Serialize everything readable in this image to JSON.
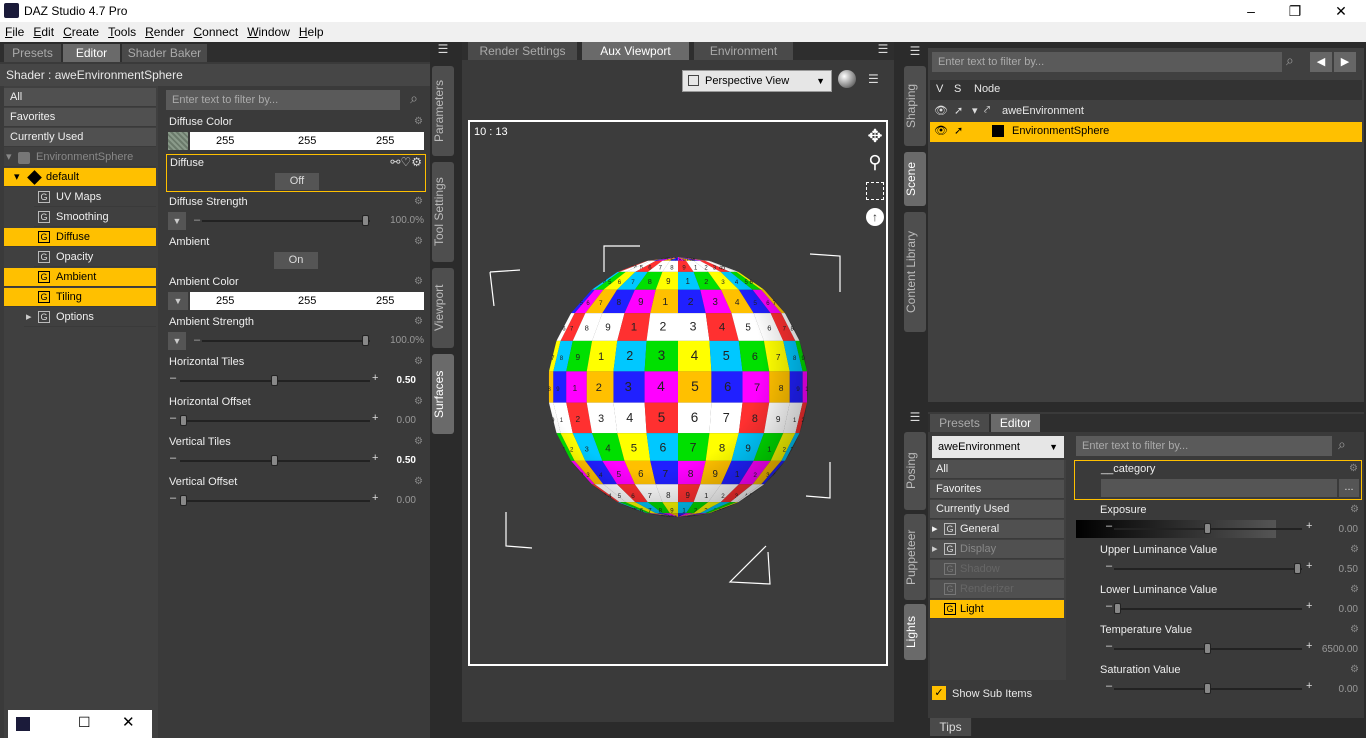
{
  "window": {
    "title": "DAZ Studio 4.7 Pro",
    "min": "–",
    "max": "❐",
    "close": "✕"
  },
  "menu": [
    "File",
    "Edit",
    "Create",
    "Tools",
    "Render",
    "Connect",
    "Window",
    "Help"
  ],
  "left": {
    "tabs": [
      "Presets",
      "Editor",
      "Shader Baker"
    ],
    "shader_label": "Shader : aweEnvironmentSphere",
    "filter_placeholder": "Enter text to filter by...",
    "categories": [
      "All",
      "Favorites",
      "Currently Used"
    ],
    "tree": [
      {
        "label": "EnvironmentSphere"
      },
      {
        "label": "default"
      },
      {
        "label": "UV Maps"
      },
      {
        "label": "Smoothing"
      },
      {
        "label": "Diffuse"
      },
      {
        "label": "Opacity"
      },
      {
        "label": "Ambient"
      },
      {
        "label": "Tiling"
      },
      {
        "label": "Options"
      }
    ],
    "props": {
      "diffuse_color": {
        "name": "Diffuse Color",
        "r": "255",
        "g": "255",
        "b": "255"
      },
      "diffuse": {
        "name": "Diffuse",
        "value": "Off"
      },
      "diffuse_strength": {
        "name": "Diffuse Strength",
        "value": "100.0%",
        "level": 1.0
      },
      "ambient": {
        "name": "Ambient",
        "value": "On"
      },
      "ambient_color": {
        "name": "Ambient Color",
        "r": "255",
        "g": "255",
        "b": "255"
      },
      "ambient_strength": {
        "name": "Ambient Strength",
        "value": "100.0%",
        "level": 1.0
      },
      "horizontal_tiles": {
        "name": "Horizontal Tiles",
        "value": "0.50",
        "level": 0.5
      },
      "horizontal_offset": {
        "name": "Horizontal Offset",
        "value": "0.00",
        "level": 0.0
      },
      "vertical_tiles": {
        "name": "Vertical Tiles",
        "value": "0.50",
        "level": 0.5
      },
      "vertical_offset": {
        "name": "Vertical Offset",
        "value": "0.00",
        "level": 0.0
      }
    }
  },
  "left_vtabs": [
    "Parameters",
    "Tool Settings",
    "Viewport",
    "Surfaces"
  ],
  "center": {
    "tabs": [
      "Render Settings",
      "Aux Viewport",
      "Environment"
    ],
    "view_select": "Perspective View",
    "fps": "10 : 13",
    "sphere_digits": [
      "2",
      "3",
      "4",
      "5",
      "6",
      "7",
      "8",
      "9",
      "1"
    ],
    "sphere_colors": [
      "#ff00ff",
      "#00c8ff",
      "#ffffff",
      "#ffc000",
      "#00e000",
      "#ff3030",
      "#2020ff",
      "#ffff00",
      "#ffffff"
    ]
  },
  "right_vtabs": [
    "Shaping",
    "Scene",
    "Content Library"
  ],
  "right_vtabs2": [
    "Posing",
    "Puppeteer",
    "Lights"
  ],
  "scene": {
    "filter_placeholder": "Enter text to filter by...",
    "headers": [
      "V",
      "S",
      "Node"
    ],
    "nodes": [
      {
        "label": "aweEnvironment"
      },
      {
        "label": "EnvironmentSphere"
      }
    ]
  },
  "editor": {
    "tabs": [
      "Presets",
      "Editor"
    ],
    "node_select": "aweEnvironment",
    "filter_placeholder": "Enter text to filter by...",
    "categories": [
      "All",
      "Favorites",
      "Currently Used"
    ],
    "groups": [
      "General",
      "Display",
      "Shadow",
      "Renderizer",
      "Light"
    ],
    "show_sub": "Show Sub Items",
    "props": {
      "category": {
        "name": "__category",
        "btn": "..."
      },
      "exposure": {
        "name": "Exposure",
        "value": "0.00",
        "level": 0.5
      },
      "upper": {
        "name": "Upper Luminance Value",
        "value": "0.50",
        "level": 1.0
      },
      "lower": {
        "name": "Lower Luminance Value",
        "value": "0.00",
        "level": 0.0
      },
      "temperature": {
        "name": "Temperature Value",
        "value": "6500.00",
        "level": 0.5
      },
      "saturation": {
        "name": "Saturation Value",
        "value": "0.00",
        "level": 0.5
      }
    },
    "tips": "Tips"
  }
}
